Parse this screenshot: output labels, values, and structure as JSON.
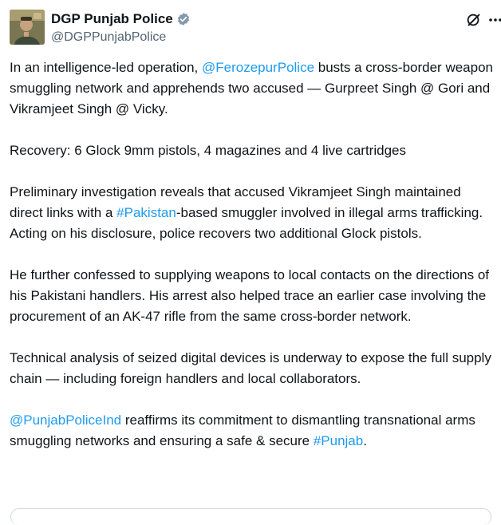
{
  "author": {
    "display_name": "DGP Punjab Police",
    "handle": "@DGPPunjabPolice",
    "verified": true,
    "verified_color": "#829aab"
  },
  "icons": {
    "avatar": "profile-photo",
    "verified": "verified-badge-icon",
    "grok": "grok-icon",
    "more": "more-options-icon"
  },
  "colors": {
    "link": "#1d9bf0",
    "text": "#0f1419",
    "muted": "#536471"
  },
  "post": {
    "p1": {
      "before": "In an intelligence-led operation, ",
      "mention": "@FerozepurPolice",
      "after": " busts a cross-border weapon smuggling network and apprehends two accused — Gurpreet Singh @ Gori and Vikramjeet Singh @ Vicky."
    },
    "p2": "Recovery: 6 Glock 9mm pistols, 4 magazines and 4 live cartridges",
    "p3": {
      "before": "Preliminary investigation reveals that accused Vikramjeet Singh maintained direct links with a ",
      "hashtag": "#Pakistan",
      "after": "-based smuggler involved in illegal arms trafficking. Acting on his disclosure, police recovers two additional Glock pistols."
    },
    "p4": "He further confessed to supplying weapons to local contacts on the directions of his Pakistani handlers. His arrest also helped trace an earlier case involving the procurement of an AK-47 rifle from the same cross-border network.",
    "p5": "Technical analysis of seized digital devices is underway to expose the full supply chain — including foreign handlers and local collaborators.",
    "p6": {
      "mention": "@PunjabPoliceInd",
      "middle": " reaffirms its commitment to dismantling transnational arms smuggling networks and ensuring a safe & secure ",
      "hashtag": "#Punjab",
      "after": "."
    }
  }
}
